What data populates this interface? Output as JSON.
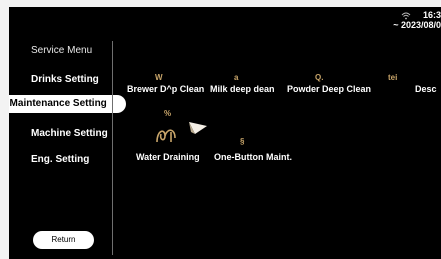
{
  "status_bar": {
    "time": "16:3",
    "date": "~ 2023/08/0"
  },
  "sidebar": {
    "title": "Service Menu",
    "items": [
      {
        "label": "Drinks Setting"
      },
      {
        "label": "l Maintenance Setting"
      },
      {
        "label": "Machine Setting"
      },
      {
        "label": "Eng. Setting"
      }
    ],
    "return_label": "Return"
  },
  "main": {
    "row1": [
      {
        "icon_text": "W",
        "label": "Brewer D^p Clean"
      },
      {
        "icon_text": "a",
        "label": "Milk deep dean"
      },
      {
        "icon_text": "Q.",
        "label": "Powder Deep Clean"
      },
      {
        "icon_text": "tei",
        "label": "Desc"
      }
    ],
    "row2": [
      {
        "icon_text": "%",
        "label": "Water Draining"
      },
      {
        "icon_text": "§",
        "label": "One-Button Maint."
      }
    ]
  },
  "colors": {
    "background": "#000000",
    "icon_accent": "#c8a56a",
    "selected_bg": "#ffffff"
  }
}
